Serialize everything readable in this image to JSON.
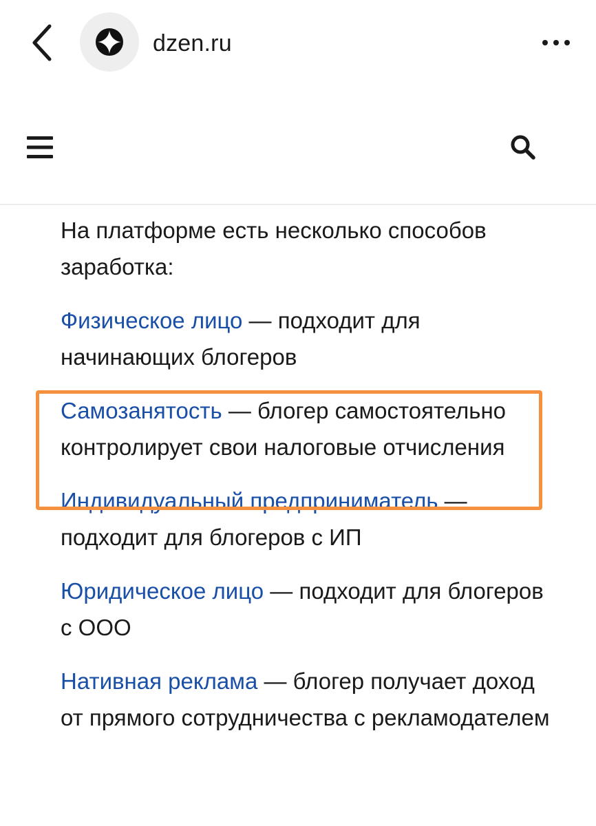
{
  "browser": {
    "domain": "dzen.ru",
    "back_icon": "chevron-left-icon",
    "site_icon": "dzen-logo-icon",
    "more_icon": "more-horizontal-icon"
  },
  "header": {
    "menu_icon": "hamburger-icon",
    "search_icon": "search-icon"
  },
  "article": {
    "intro": "На платформе есть несколько способов заработка:",
    "items": [
      {
        "link": "Физическое лицо",
        "rest": " — подходит для начинающих блогеров"
      },
      {
        "link": "Самозанятость",
        "rest": " — блогер самостоятельно контролирует свои налоговые отчисления"
      },
      {
        "link": "Индивидуальный предприниматель",
        "rest": " — подходит для блогеров с ИП"
      },
      {
        "link": "Юридическое лицо",
        "rest": " — подходит для блогеров с ООО"
      },
      {
        "link": "Нативная реклама",
        "rest": " — блогер получает доход от прямого сотрудничества с рекламодателем"
      }
    ]
  },
  "colors": {
    "link": "#1a4fa8",
    "highlight": "#f5913e",
    "text": "#1a1a1a"
  }
}
